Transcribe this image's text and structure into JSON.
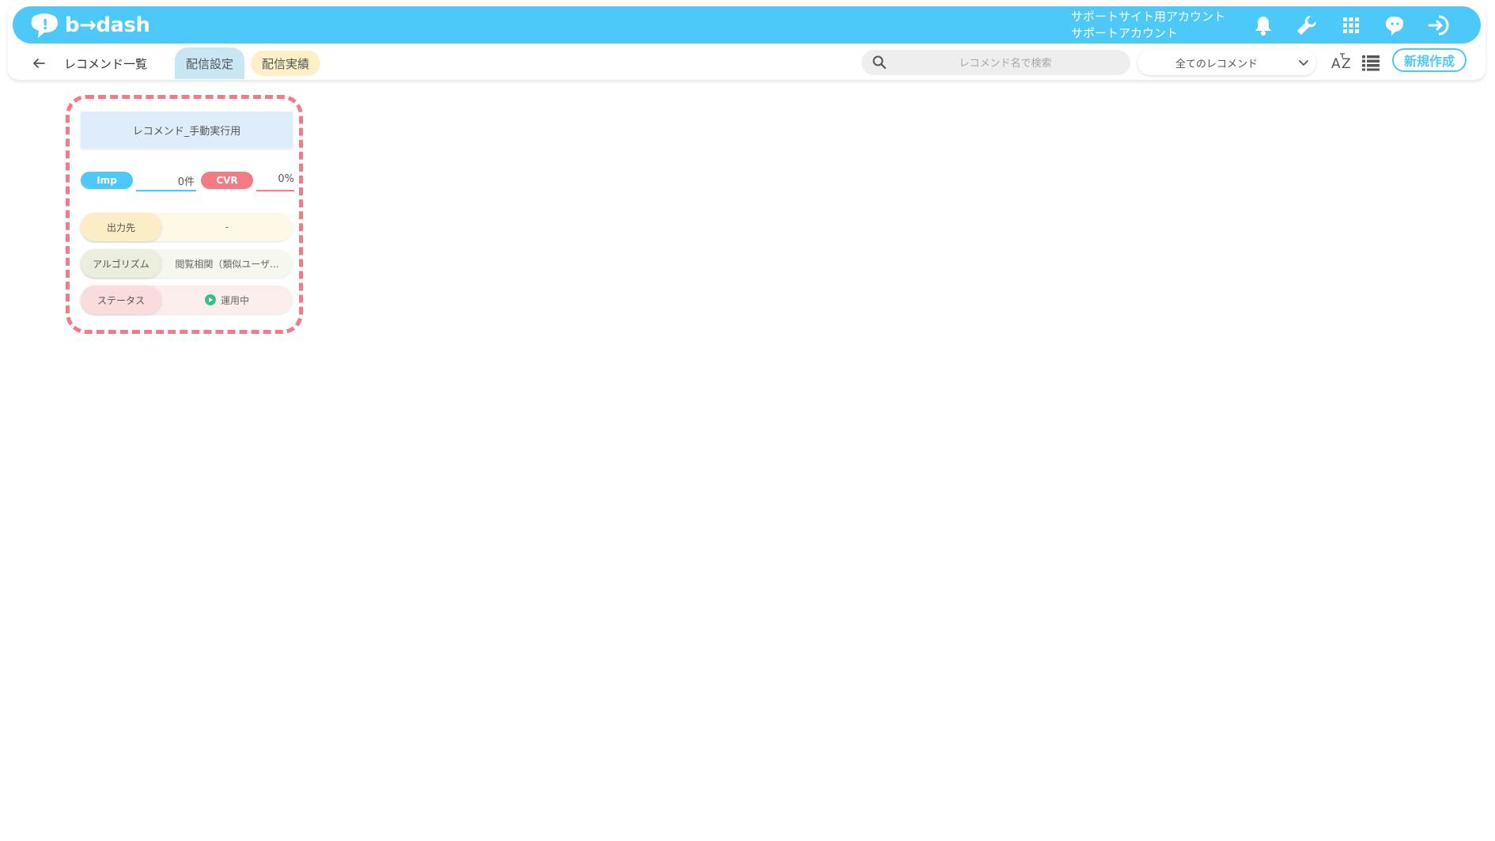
{
  "brand": {
    "logo_text": "b→dash",
    "accent_color": "#4cc9f8",
    "red_color": "#f37b85"
  },
  "header": {
    "account_line1": "サポートサイト用アカウント",
    "account_line2": "サポートアカウント",
    "icons": [
      "bell-icon",
      "wrench-icon",
      "apps-grid-icon",
      "mascot-icon",
      "logout-icon"
    ]
  },
  "subheader": {
    "breadcrumb": "レコメンド一覧",
    "tabs": [
      {
        "label": "配信設定",
        "active": true
      },
      {
        "label": "配信実績",
        "active": false
      }
    ],
    "search_placeholder": "レコメンド名で検索",
    "filter_selected": "全てのレコメンド",
    "new_button": "新規作成"
  },
  "card": {
    "title": "レコメンド_手動実行用",
    "imp_label": "Imp",
    "imp_value": "0件",
    "cvr_label": "CVR",
    "cvr_value": "0%",
    "rows": [
      {
        "label": "出力先",
        "value": "-"
      },
      {
        "label": "アルゴリズム",
        "value": "閲覧相関（類似ユーザ..."
      },
      {
        "label": "ステータス",
        "value": "運用中"
      }
    ]
  }
}
